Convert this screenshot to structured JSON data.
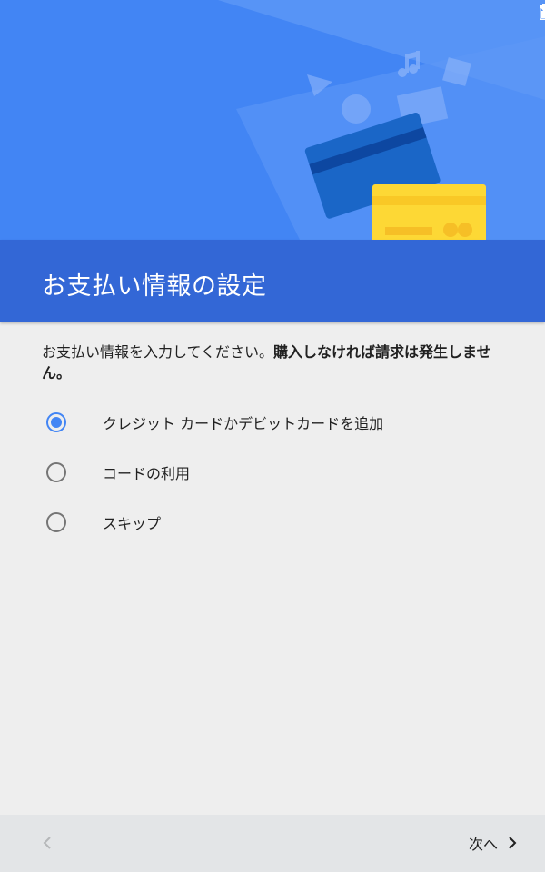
{
  "status_bar": {
    "icons": [
      "wifi-icon",
      "battery-icon"
    ]
  },
  "header": {
    "title": "お支払い情報の設定",
    "illustration_icons": [
      "music-note-icon",
      "play-icon",
      "book-icon",
      "film-icon",
      "credit-card-icon"
    ]
  },
  "main": {
    "description_regular": "お支払い情報を入力してください。",
    "description_bold": "購入しなければ請求は発生しません。",
    "payment_options": [
      {
        "label": "クレジット カードかデビットカードを追加",
        "selected": true
      },
      {
        "label": "コードの利用",
        "selected": false
      },
      {
        "label": "スキップ",
        "selected": false
      }
    ]
  },
  "footer": {
    "back_icon": "chevron-left-icon",
    "next_label": "次へ",
    "next_icon": "chevron-right-icon"
  },
  "colors": {
    "header_light": "#4285f4",
    "header_dark": "#3367d6",
    "accent": "#4285f4",
    "card_blue": "#1e6fd0",
    "card_yellow": "#fdd835",
    "background": "#eeeeee",
    "footer_bg": "#e3e5e7"
  }
}
